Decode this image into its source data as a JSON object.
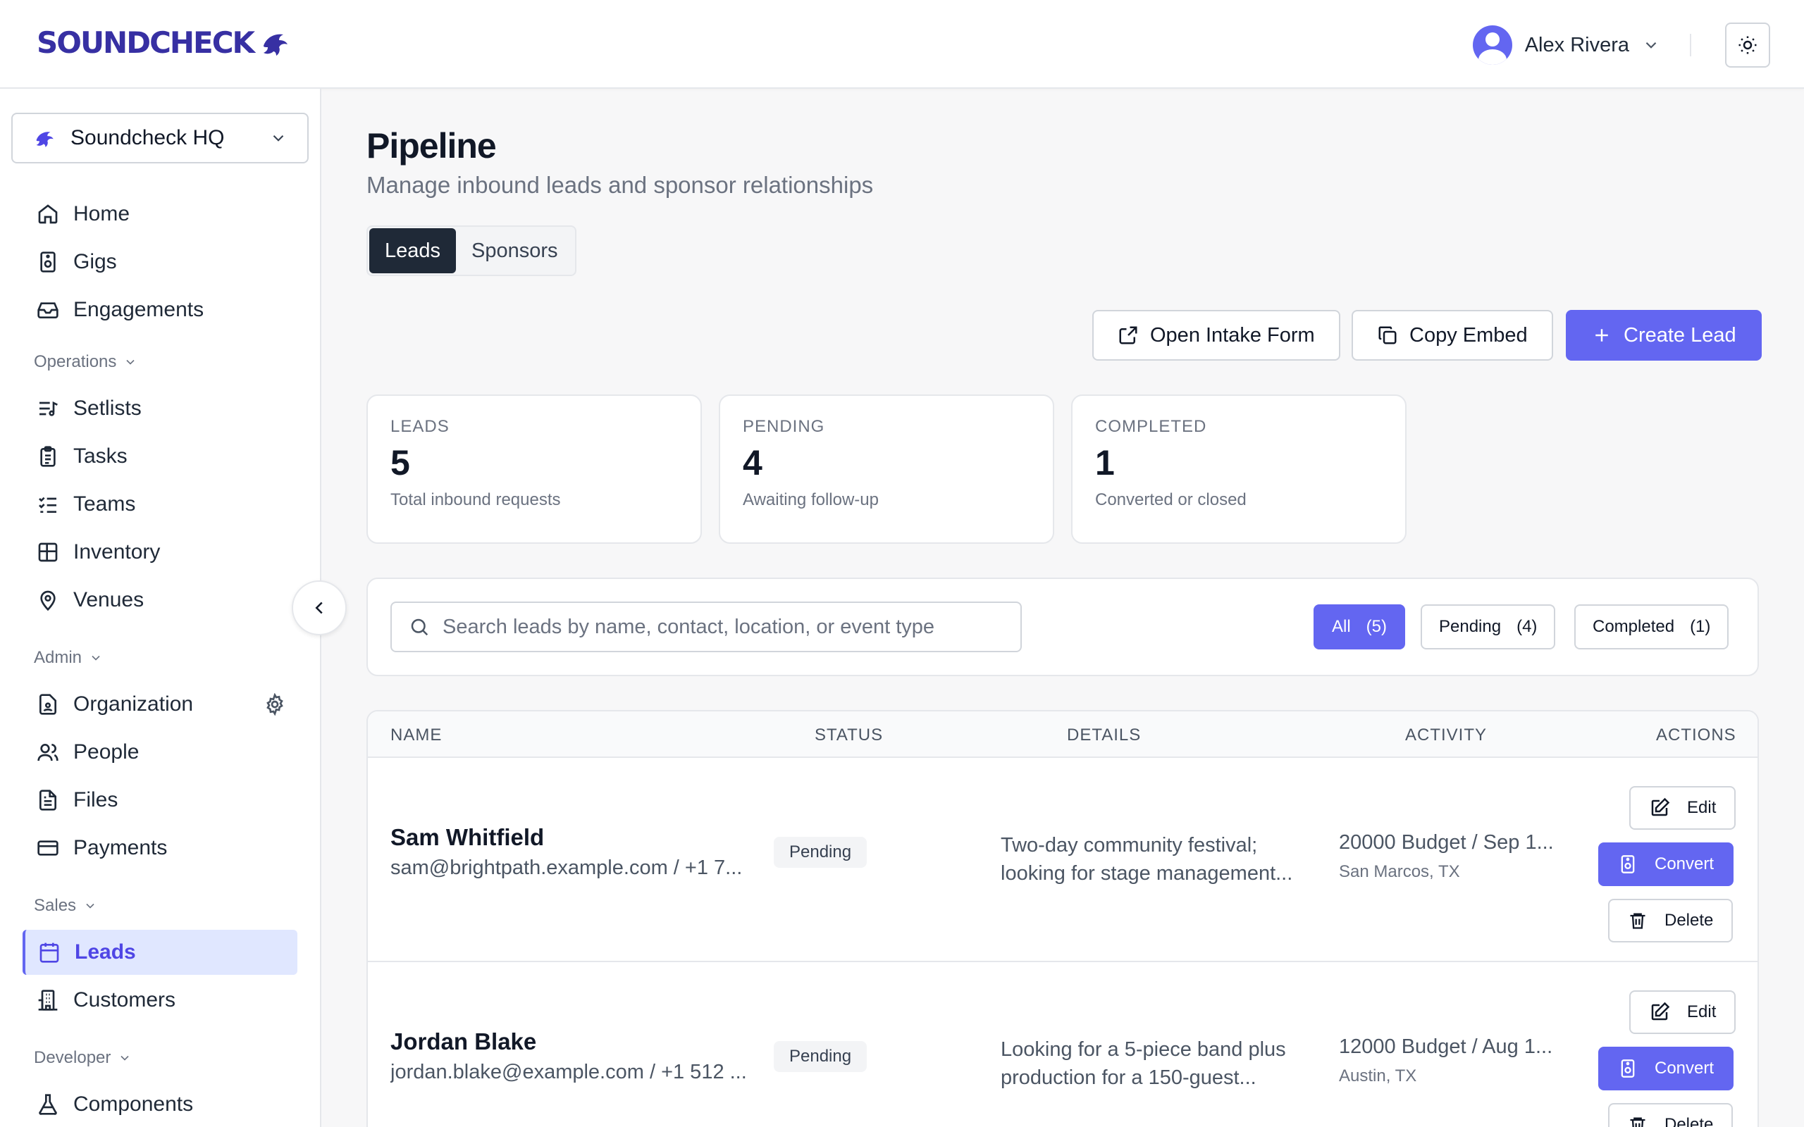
{
  "brand": {
    "logo_text": "SOUNDCHECK"
  },
  "user": {
    "name": "Alex Rivera"
  },
  "sidebar": {
    "org": "Soundcheck HQ",
    "top_items": [
      {
        "label": "Home",
        "icon": "home-icon"
      },
      {
        "label": "Gigs",
        "icon": "speaker-icon"
      },
      {
        "label": "Engagements",
        "icon": "inbox-icon"
      }
    ],
    "sections": [
      {
        "label": "Operations",
        "items": [
          {
            "label": "Setlists",
            "icon": "list-music-icon"
          },
          {
            "label": "Tasks",
            "icon": "clipboard-icon"
          },
          {
            "label": "Teams",
            "icon": "list-checks-icon"
          },
          {
            "label": "Inventory",
            "icon": "grid-icon"
          },
          {
            "label": "Venues",
            "icon": "map-pin-icon"
          }
        ]
      },
      {
        "label": "Admin",
        "items": [
          {
            "label": "Organization",
            "icon": "file-user-icon"
          },
          {
            "label": "People",
            "icon": "users-icon"
          },
          {
            "label": "Files",
            "icon": "file-text-icon"
          },
          {
            "label": "Payments",
            "icon": "credit-card-icon"
          }
        ]
      },
      {
        "label": "Sales",
        "items": [
          {
            "label": "Leads",
            "icon": "calendar-icon",
            "active": true
          },
          {
            "label": "Customers",
            "icon": "building-icon"
          }
        ]
      },
      {
        "label": "Developer",
        "items": [
          {
            "label": "Components",
            "icon": "flask-icon"
          }
        ]
      }
    ]
  },
  "page": {
    "title": "Pipeline",
    "subtitle": "Manage inbound leads and sponsor relationships",
    "tabs": [
      "Leads",
      "Sponsors"
    ],
    "actions": {
      "intake": "Open Intake Form",
      "embed": "Copy Embed",
      "create": "Create Lead"
    }
  },
  "stats": [
    {
      "label": "LEADS",
      "value": "5",
      "desc": "Total inbound requests"
    },
    {
      "label": "PENDING",
      "value": "4",
      "desc": "Awaiting follow-up"
    },
    {
      "label": "COMPLETED",
      "value": "1",
      "desc": "Converted or closed"
    }
  ],
  "filters": {
    "search_placeholder": "Search leads by name, contact, location, or event type",
    "chips": [
      {
        "label": "All",
        "count": "(5)"
      },
      {
        "label": "Pending",
        "count": "(4)"
      },
      {
        "label": "Completed",
        "count": "(1)"
      }
    ]
  },
  "table": {
    "columns": [
      "NAME",
      "STATUS",
      "DETAILS",
      "ACTIVITY",
      "ACTIONS"
    ],
    "action_labels": {
      "edit": "Edit",
      "convert": "Convert",
      "delete": "Delete"
    },
    "rows": [
      {
        "name": "Sam Whitfield",
        "contact": "sam@brightpath.example.com / +1 7...",
        "status": "Pending",
        "details": "Two-day community festival; looking for stage management...",
        "activity": "20000 Budget / Sep 1...",
        "location": "San Marcos, TX"
      },
      {
        "name": "Jordan Blake",
        "contact": "jordan.blake@example.com / +1 512 ...",
        "status": "Pending",
        "details": "Looking for a 5-piece band plus production for a 150-guest...",
        "activity": "12000 Budget / Aug 1...",
        "location": "Austin, TX"
      }
    ]
  },
  "colors": {
    "accent": "#6366f1",
    "active_bg": "#e0e7ff",
    "dark": "#1f2937"
  }
}
